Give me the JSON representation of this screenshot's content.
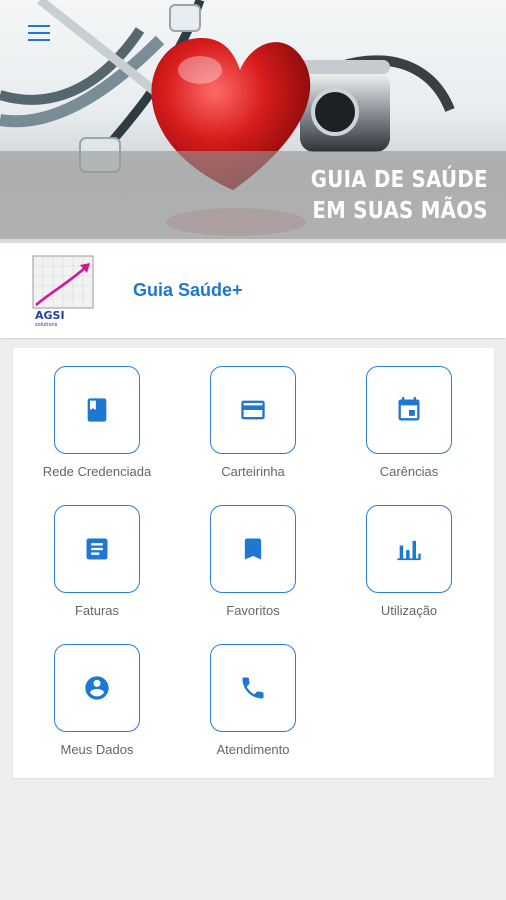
{
  "banner": {
    "line1": "GUIA DE SAÚDE",
    "line2": "EM SUAS MÃOS"
  },
  "header": {
    "app_title": "Guia Saúde+",
    "logo_text": "AGSI",
    "logo_subtext": "solutions"
  },
  "menu": {
    "icon": "hamburger-menu-icon"
  },
  "tiles": [
    {
      "label": "Rede Credenciada",
      "icon": "book-icon"
    },
    {
      "label": "Carteirinha",
      "icon": "credit-card-icon"
    },
    {
      "label": "Carências",
      "icon": "calendar-icon"
    },
    {
      "label": "Faturas",
      "icon": "document-icon"
    },
    {
      "label": "Favoritos",
      "icon": "bookmark-icon"
    },
    {
      "label": "Utilização",
      "icon": "bar-chart-icon"
    },
    {
      "label": "Meus Dados",
      "icon": "account-circle-icon"
    },
    {
      "label": "Atendimento",
      "icon": "phone-icon"
    }
  ],
  "colors": {
    "accent": "#1e78d2",
    "label": "#666666",
    "background": "#eeeeee",
    "heart": "#d01818"
  }
}
